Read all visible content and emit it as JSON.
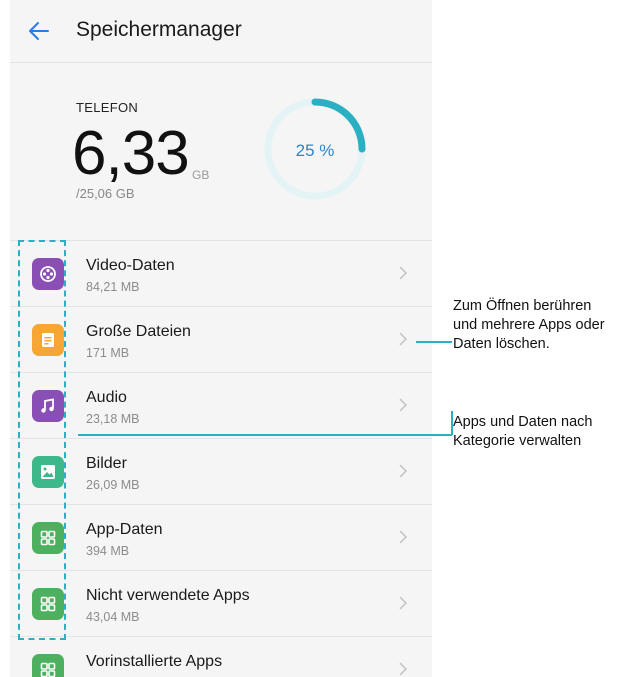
{
  "header": {
    "title": "Speichermanager"
  },
  "storage": {
    "label": "TELEFON",
    "used": "6,33",
    "unit": "GB",
    "total": "/25,06 GB",
    "percent_label": "25 %",
    "percent": 25
  },
  "colors": {
    "accent": "#2bb0c3",
    "video": "#8a4fb5",
    "large": "#f7a535",
    "audio": "#8a4fb5",
    "images": "#3cb88a",
    "apps": "#4cb05e"
  },
  "items": [
    {
      "name": "Video-Daten",
      "size": "84,21 MB",
      "icon": "video-icon"
    },
    {
      "name": "Große Dateien",
      "size": "171 MB",
      "icon": "document-icon"
    },
    {
      "name": "Audio",
      "size": "23,18 MB",
      "icon": "music-icon"
    },
    {
      "name": "Bilder",
      "size": "26,09 MB",
      "icon": "image-icon"
    },
    {
      "name": "App-Daten",
      "size": "394 MB",
      "icon": "apps-grid-icon"
    },
    {
      "name": "Nicht verwendete Apps",
      "size": "43,04 MB",
      "icon": "apps-grid-icon"
    },
    {
      "name": "Vorinstallierte Apps",
      "size": "",
      "icon": "apps-grid-icon"
    }
  ],
  "callouts": {
    "tap_text": "Zum Öffnen berühren und mehrere Apps oder Daten löschen.",
    "category_text": "Apps und Daten nach Kategorie verwalten"
  }
}
